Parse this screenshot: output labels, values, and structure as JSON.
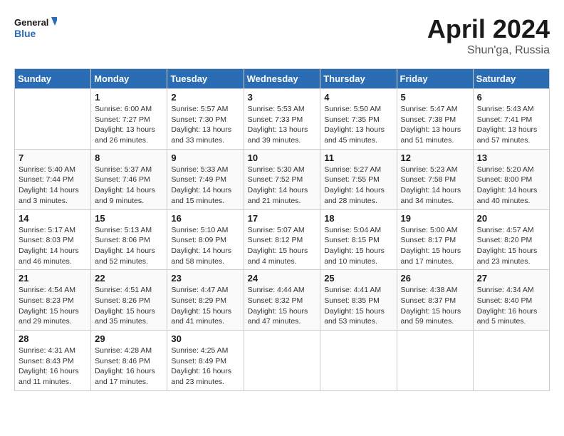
{
  "header": {
    "logo_line1": "General",
    "logo_line2": "Blue",
    "month": "April 2024",
    "location": "Shun'ga, Russia"
  },
  "weekdays": [
    "Sunday",
    "Monday",
    "Tuesday",
    "Wednesday",
    "Thursday",
    "Friday",
    "Saturday"
  ],
  "weeks": [
    [
      {
        "day": "",
        "info": ""
      },
      {
        "day": "1",
        "info": "Sunrise: 6:00 AM\nSunset: 7:27 PM\nDaylight: 13 hours\nand 26 minutes."
      },
      {
        "day": "2",
        "info": "Sunrise: 5:57 AM\nSunset: 7:30 PM\nDaylight: 13 hours\nand 33 minutes."
      },
      {
        "day": "3",
        "info": "Sunrise: 5:53 AM\nSunset: 7:33 PM\nDaylight: 13 hours\nand 39 minutes."
      },
      {
        "day": "4",
        "info": "Sunrise: 5:50 AM\nSunset: 7:35 PM\nDaylight: 13 hours\nand 45 minutes."
      },
      {
        "day": "5",
        "info": "Sunrise: 5:47 AM\nSunset: 7:38 PM\nDaylight: 13 hours\nand 51 minutes."
      },
      {
        "day": "6",
        "info": "Sunrise: 5:43 AM\nSunset: 7:41 PM\nDaylight: 13 hours\nand 57 minutes."
      }
    ],
    [
      {
        "day": "7",
        "info": "Sunrise: 5:40 AM\nSunset: 7:44 PM\nDaylight: 14 hours\nand 3 minutes."
      },
      {
        "day": "8",
        "info": "Sunrise: 5:37 AM\nSunset: 7:46 PM\nDaylight: 14 hours\nand 9 minutes."
      },
      {
        "day": "9",
        "info": "Sunrise: 5:33 AM\nSunset: 7:49 PM\nDaylight: 14 hours\nand 15 minutes."
      },
      {
        "day": "10",
        "info": "Sunrise: 5:30 AM\nSunset: 7:52 PM\nDaylight: 14 hours\nand 21 minutes."
      },
      {
        "day": "11",
        "info": "Sunrise: 5:27 AM\nSunset: 7:55 PM\nDaylight: 14 hours\nand 28 minutes."
      },
      {
        "day": "12",
        "info": "Sunrise: 5:23 AM\nSunset: 7:58 PM\nDaylight: 14 hours\nand 34 minutes."
      },
      {
        "day": "13",
        "info": "Sunrise: 5:20 AM\nSunset: 8:00 PM\nDaylight: 14 hours\nand 40 minutes."
      }
    ],
    [
      {
        "day": "14",
        "info": "Sunrise: 5:17 AM\nSunset: 8:03 PM\nDaylight: 14 hours\nand 46 minutes."
      },
      {
        "day": "15",
        "info": "Sunrise: 5:13 AM\nSunset: 8:06 PM\nDaylight: 14 hours\nand 52 minutes."
      },
      {
        "day": "16",
        "info": "Sunrise: 5:10 AM\nSunset: 8:09 PM\nDaylight: 14 hours\nand 58 minutes."
      },
      {
        "day": "17",
        "info": "Sunrise: 5:07 AM\nSunset: 8:12 PM\nDaylight: 15 hours\nand 4 minutes."
      },
      {
        "day": "18",
        "info": "Sunrise: 5:04 AM\nSunset: 8:15 PM\nDaylight: 15 hours\nand 10 minutes."
      },
      {
        "day": "19",
        "info": "Sunrise: 5:00 AM\nSunset: 8:17 PM\nDaylight: 15 hours\nand 17 minutes."
      },
      {
        "day": "20",
        "info": "Sunrise: 4:57 AM\nSunset: 8:20 PM\nDaylight: 15 hours\nand 23 minutes."
      }
    ],
    [
      {
        "day": "21",
        "info": "Sunrise: 4:54 AM\nSunset: 8:23 PM\nDaylight: 15 hours\nand 29 minutes."
      },
      {
        "day": "22",
        "info": "Sunrise: 4:51 AM\nSunset: 8:26 PM\nDaylight: 15 hours\nand 35 minutes."
      },
      {
        "day": "23",
        "info": "Sunrise: 4:47 AM\nSunset: 8:29 PM\nDaylight: 15 hours\nand 41 minutes."
      },
      {
        "day": "24",
        "info": "Sunrise: 4:44 AM\nSunset: 8:32 PM\nDaylight: 15 hours\nand 47 minutes."
      },
      {
        "day": "25",
        "info": "Sunrise: 4:41 AM\nSunset: 8:35 PM\nDaylight: 15 hours\nand 53 minutes."
      },
      {
        "day": "26",
        "info": "Sunrise: 4:38 AM\nSunset: 8:37 PM\nDaylight: 15 hours\nand 59 minutes."
      },
      {
        "day": "27",
        "info": "Sunrise: 4:34 AM\nSunset: 8:40 PM\nDaylight: 16 hours\nand 5 minutes."
      }
    ],
    [
      {
        "day": "28",
        "info": "Sunrise: 4:31 AM\nSunset: 8:43 PM\nDaylight: 16 hours\nand 11 minutes."
      },
      {
        "day": "29",
        "info": "Sunrise: 4:28 AM\nSunset: 8:46 PM\nDaylight: 16 hours\nand 17 minutes."
      },
      {
        "day": "30",
        "info": "Sunrise: 4:25 AM\nSunset: 8:49 PM\nDaylight: 16 hours\nand 23 minutes."
      },
      {
        "day": "",
        "info": ""
      },
      {
        "day": "",
        "info": ""
      },
      {
        "day": "",
        "info": ""
      },
      {
        "day": "",
        "info": ""
      }
    ]
  ]
}
